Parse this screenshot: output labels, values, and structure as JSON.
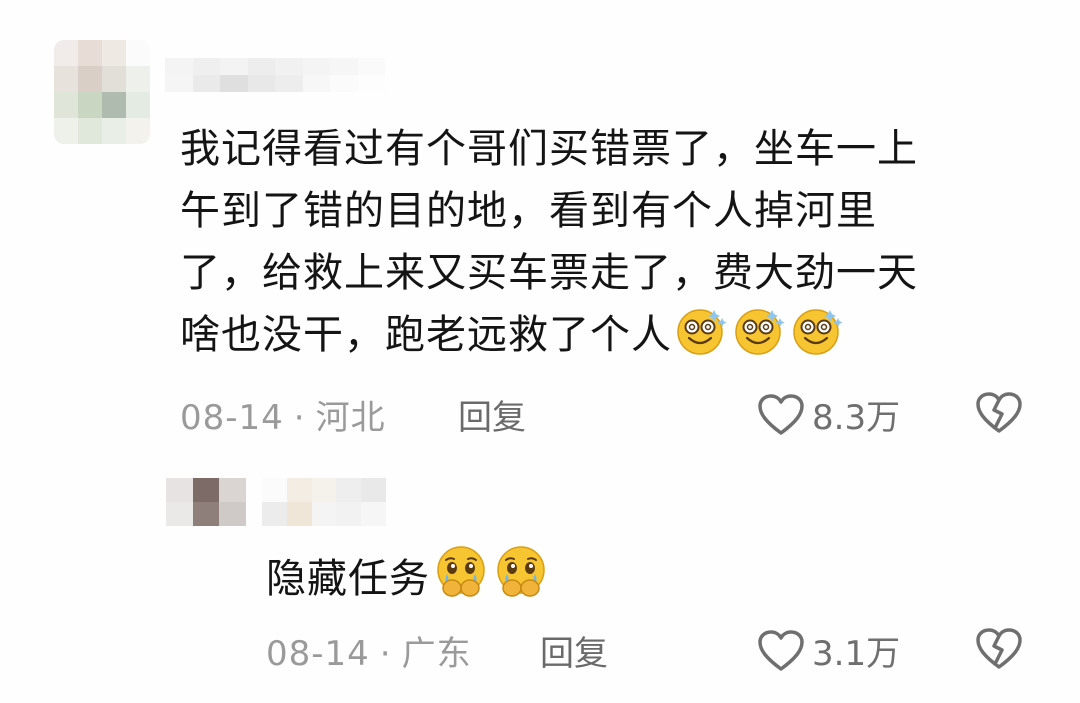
{
  "comments": [
    {
      "text_lines": [
        "我记得看过有个哥们买错票了，坐车一上",
        "午到了错的目的地，看到有个人掉河里",
        "了，给救上来又买车票走了，费大劲一天",
        "啥也没干，跑老远救了个人"
      ],
      "emoji": [
        "dizzy-smile-emoji",
        "dizzy-smile-emoji",
        "dizzy-smile-emoji"
      ],
      "date": "08-14",
      "separator": "·",
      "location": "河北",
      "reply_label": "回复",
      "like_count": "8.3万"
    },
    {
      "text": "隐藏任务",
      "emoji": [
        "holding-back-tears-emoji",
        "holding-back-tears-emoji"
      ],
      "date": "08-14",
      "separator": "·",
      "location": "广东",
      "reply_label": "回复",
      "like_count": "3.1万"
    }
  ],
  "colors": {
    "background": "#fefefe",
    "text": "#141414",
    "meta": "#9a9a9a",
    "icon": "#6f6f6f",
    "emoji_yellow": "#f7c531"
  }
}
